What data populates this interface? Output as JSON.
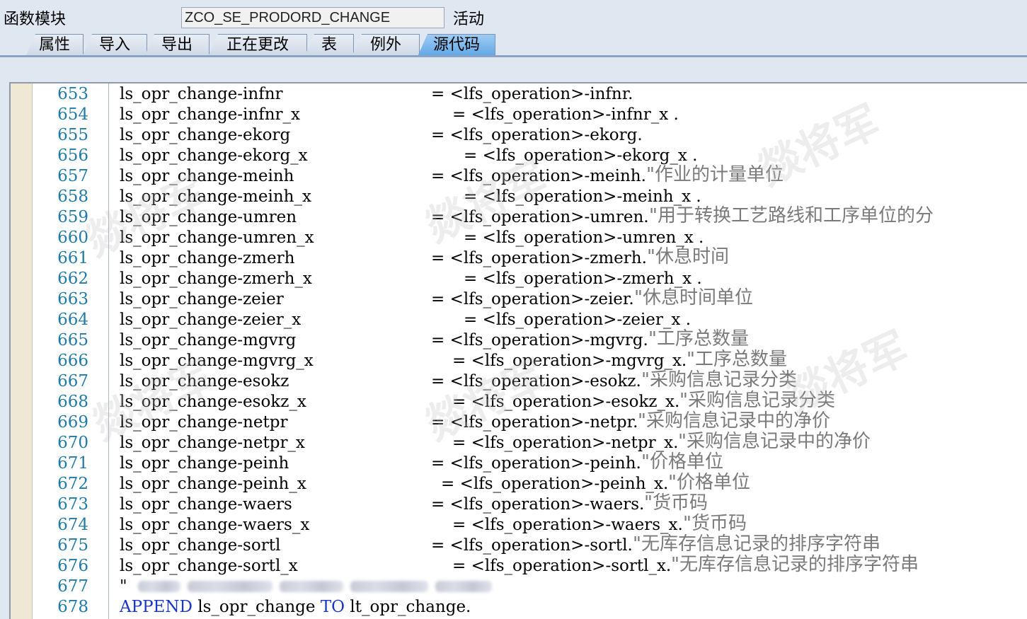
{
  "header": {
    "label": "函数模块",
    "function_name": "ZCO_SE_PRODORD_CHANGE",
    "status": "活动"
  },
  "tabs": [
    "属性",
    "导入",
    "导出",
    "正在更改",
    "表",
    "例外",
    "源代码"
  ],
  "active_tab": "源代码",
  "code_lines": [
    {
      "num": "653",
      "lhs": "ls_opr_change-infnr",
      "rhs": "= <lfs_operation>-infnr.",
      "comment": ""
    },
    {
      "num": "654",
      "lhs": "ls_opr_change-infnr_x",
      "rhs": "= <lfs_operation>-infnr_x .",
      "comment": ""
    },
    {
      "num": "655",
      "lhs": "ls_opr_change-ekorg",
      "rhs": "= <lfs_operation>-ekorg.",
      "comment": ""
    },
    {
      "num": "656",
      "lhs": "ls_opr_change-ekorg_x",
      "rhs": "= <lfs_operation>-ekorg_x .",
      "comment": ""
    },
    {
      "num": "657",
      "lhs": "ls_opr_change-meinh",
      "rhs": "= <lfs_operation>-meinh.",
      "comment": "\"作业的计量单位"
    },
    {
      "num": "658",
      "lhs": "ls_opr_change-meinh_x",
      "rhs": "= <lfs_operation>-meinh_x .",
      "comment": ""
    },
    {
      "num": "659",
      "lhs": "ls_opr_change-umren",
      "rhs": "= <lfs_operation>-umren.",
      "comment": "\"用于转换工艺路线和工序单位的分"
    },
    {
      "num": "660",
      "lhs": "ls_opr_change-umren_x",
      "rhs": "= <lfs_operation>-umren_x .",
      "comment": ""
    },
    {
      "num": "661",
      "lhs": "ls_opr_change-zmerh",
      "rhs": "= <lfs_operation>-zmerh.",
      "comment": "\"休息时间"
    },
    {
      "num": "662",
      "lhs": "ls_opr_change-zmerh_x",
      "rhs": "= <lfs_operation>-zmerh_x .",
      "comment": ""
    },
    {
      "num": "663",
      "lhs": "ls_opr_change-zeier",
      "rhs": "= <lfs_operation>-zeier.",
      "comment": "\"休息时间单位"
    },
    {
      "num": "664",
      "lhs": "ls_opr_change-zeier_x",
      "rhs": "= <lfs_operation>-zeier_x .",
      "comment": ""
    },
    {
      "num": "665",
      "lhs": "ls_opr_change-mgvrg",
      "rhs": "= <lfs_operation>-mgvrg.",
      "comment": "\"工序总数量"
    },
    {
      "num": "666",
      "lhs": "ls_opr_change-mgvrg_x",
      "rhs": "= <lfs_operation>-mgvrg_x.",
      "comment": "\"工序总数量"
    },
    {
      "num": "667",
      "lhs": "ls_opr_change-esokz",
      "rhs": "= <lfs_operation>-esokz.",
      "comment": "\"采购信息记录分类"
    },
    {
      "num": "668",
      "lhs": "ls_opr_change-esokz_x",
      "rhs": "= <lfs_operation>-esokz_x.",
      "comment": "\"采购信息记录分类"
    },
    {
      "num": "669",
      "lhs": "ls_opr_change-netpr",
      "rhs": "= <lfs_operation>-netpr.",
      "comment": "\"采购信息记录中的净价"
    },
    {
      "num": "670",
      "lhs": "ls_opr_change-netpr_x",
      "rhs": "= <lfs_operation>-netpr_x.",
      "comment": "\"采购信息记录中的净价"
    },
    {
      "num": "671",
      "lhs": "ls_opr_change-peinh",
      "rhs": "= <lfs_operation>-peinh.",
      "comment": "\"价格单位"
    },
    {
      "num": "672",
      "lhs": "ls_opr_change-peinh_x",
      "rhs": "= <lfs_operation>-peinh_x.",
      "comment": "\"价格单位"
    },
    {
      "num": "673",
      "lhs": "ls_opr_change-waers",
      "rhs": "= <lfs_operation>-waers.",
      "comment": "\"货币码"
    },
    {
      "num": "674",
      "lhs": "ls_opr_change-waers_x",
      "rhs": "= <lfs_operation>-waers_x.",
      "comment": "\"货币码"
    },
    {
      "num": "675",
      "lhs": "ls_opr_change-sortl",
      "rhs": "= <lfs_operation>-sortl.",
      "comment": "\"无库存信息记录的排序字符串"
    },
    {
      "num": "676",
      "lhs": "ls_opr_change-sortl_x",
      "rhs": "= <lfs_operation>-sortl_x.",
      "comment": "\"无库存信息记录的排序字符串"
    },
    {
      "num": "677",
      "lhs": "\"",
      "rhs": "",
      "comment": ""
    },
    {
      "num": "678",
      "lhs": "",
      "rhs": "",
      "comment": ""
    }
  ],
  "append_line": {
    "keyword1": "APPEND",
    "var": "ls_opr_change",
    "keyword2": "TO",
    "target": "lt_opr_change."
  },
  "watermark": "燚将军",
  "colors": {
    "line_number": "#1f7aa8",
    "keyword": "#1a36c8",
    "comment": "#7a7a7a",
    "active_tab": "#5fa6e6"
  }
}
